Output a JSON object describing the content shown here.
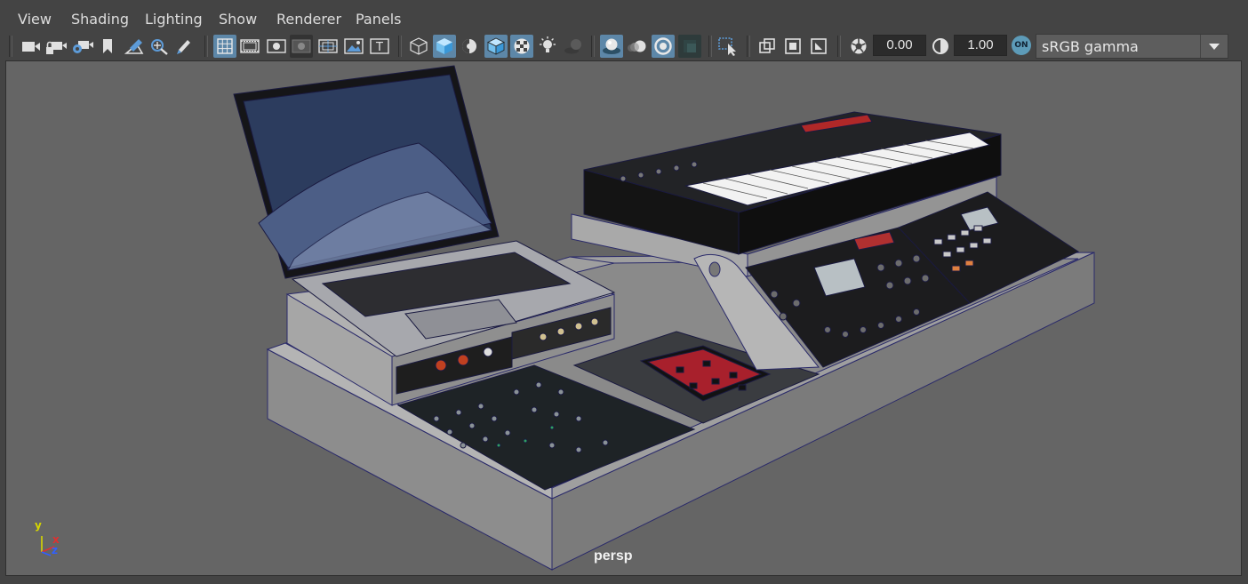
{
  "menu": {
    "items": [
      {
        "id": "view",
        "label": "View"
      },
      {
        "id": "shading",
        "label": "Shading"
      },
      {
        "id": "lighting",
        "label": "Lighting"
      },
      {
        "id": "show",
        "label": "Show"
      },
      {
        "id": "renderer",
        "label": "Renderer"
      },
      {
        "id": "panels",
        "label": "Panels"
      }
    ]
  },
  "toolbar": {
    "exposure_value": "0.00",
    "gamma_value": "1.00",
    "color_management_badge": "ON",
    "view_transform": "sRGB gamma",
    "icons": [
      "select-camera-icon",
      "lock-camera-icon",
      "camera-attributes-icon",
      "bookmark-icon",
      "image-plane-icon",
      "2d-pan-zoom-icon",
      "grease-pencil-icon",
      "grid-icon",
      "film-gate-icon",
      "resolution-gate-icon",
      "gate-mask-icon",
      "field-chart-icon",
      "safe-action-icon",
      "safe-title-icon",
      "wireframe-icon",
      "smooth-shade-icon",
      "default-material-icon",
      "wireframe-on-shaded-icon",
      "textured-icon",
      "use-all-lights-icon",
      "shadows-icon",
      "screen-space-ao-icon",
      "motion-blur-icon",
      "anti-aliasing-icon",
      "depth-of-field-icon",
      "isolate-select-icon",
      "xray-icon",
      "xray-joints-icon",
      "xray-active-icon",
      "exposure-icon",
      "gamma-icon"
    ],
    "colors": {
      "toggle_on": "#5d87a8",
      "badge": "#5d9bb8"
    }
  },
  "viewport": {
    "camera_name": "persp",
    "axis": {
      "y": "y",
      "x": "x",
      "z": "z"
    },
    "colors": {
      "background": "#656565",
      "wire": "#2a2a6a",
      "axis_y": "#d6d600",
      "axis_x": "#e03030",
      "axis_z": "#3060ff"
    }
  }
}
